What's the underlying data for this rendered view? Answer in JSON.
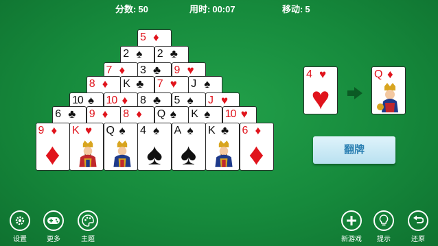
{
  "hud": {
    "score_label": "分数:",
    "score": "50",
    "time_label": "用时:",
    "time": "00:07",
    "moves_label": "移动:",
    "moves": "5"
  },
  "pyramid_rows": [
    [
      {
        "rank": "5",
        "suit": "♦",
        "color": "red"
      }
    ],
    [
      {
        "rank": "2",
        "suit": "♠",
        "color": "black"
      },
      {
        "rank": "2",
        "suit": "♣",
        "color": "black"
      }
    ],
    [
      {
        "rank": "7",
        "suit": "♦",
        "color": "red"
      },
      {
        "rank": "3",
        "suit": "♣",
        "color": "black"
      },
      {
        "rank": "9",
        "suit": "♥",
        "color": "red"
      }
    ],
    [
      {
        "rank": "8",
        "suit": "♦",
        "color": "red"
      },
      {
        "rank": "K",
        "suit": "♣",
        "color": "black"
      },
      {
        "rank": "7",
        "suit": "♥",
        "color": "red"
      },
      {
        "rank": "J",
        "suit": "♠",
        "color": "black"
      }
    ],
    [
      {
        "rank": "10",
        "suit": "♠",
        "color": "black"
      },
      {
        "rank": "10",
        "suit": "♦",
        "color": "red"
      },
      {
        "rank": "8",
        "suit": "♣",
        "color": "black"
      },
      {
        "rank": "5",
        "suit": "♠",
        "color": "black"
      },
      {
        "rank": "J",
        "suit": "♥",
        "color": "red"
      }
    ],
    [
      {
        "rank": "6",
        "suit": "♣",
        "color": "black"
      },
      {
        "rank": "9",
        "suit": "♦",
        "color": "red"
      },
      {
        "rank": "8",
        "suit": "♦",
        "color": "red"
      },
      {
        "rank": "Q",
        "suit": "♠",
        "color": "black"
      },
      {
        "rank": "K",
        "suit": "♠",
        "color": "black"
      },
      {
        "rank": "10",
        "suit": "♥",
        "color": "red"
      }
    ],
    [
      {
        "rank": "9",
        "suit": "♦",
        "color": "red"
      },
      {
        "rank": "K",
        "suit": "♥",
        "color": "red"
      },
      {
        "rank": "Q",
        "suit": "♠",
        "color": "black"
      },
      {
        "rank": "4",
        "suit": "♠",
        "color": "black"
      },
      {
        "rank": "A",
        "suit": "♠",
        "color": "black"
      },
      {
        "rank": "K",
        "suit": "♣",
        "color": "black"
      },
      {
        "rank": "6",
        "suit": "♦",
        "color": "red"
      }
    ]
  ],
  "waste_card": {
    "rank": "4",
    "suit": "♥",
    "color": "red"
  },
  "stock_card": {
    "rank": "Q",
    "suit": "♦",
    "color": "red"
  },
  "flip_button": "翻牌",
  "toolbar_left": [
    {
      "icon": "gear-icon",
      "label": "设置"
    },
    {
      "icon": "gamepad-icon",
      "label": "更多"
    },
    {
      "icon": "palette-icon",
      "label": "主题"
    }
  ],
  "toolbar_right": [
    {
      "icon": "plus-icon",
      "label": "新游戏"
    },
    {
      "icon": "lightbulb-icon",
      "label": "提示"
    },
    {
      "icon": "undo-icon",
      "label": "还原"
    }
  ],
  "colors": {
    "red": "#e0141c",
    "black": "#111111",
    "felt": "#168a3c",
    "button_text": "#2a7fb2"
  }
}
